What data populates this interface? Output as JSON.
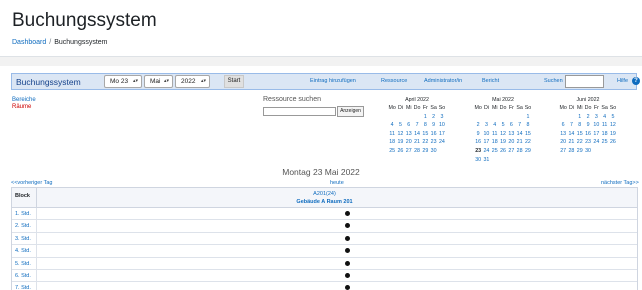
{
  "header": {
    "title": "Buchungssystem",
    "breadcrumb": [
      {
        "label": "Dashboard"
      },
      {
        "label": "Buchungssystem"
      }
    ],
    "separator": "/"
  },
  "toolbar": {
    "title": "Buchungssystem",
    "day_select": "Mo 23",
    "month_select": "Mai",
    "year_select": "2022",
    "start_label": "Start",
    "links": {
      "add_entry": "Eintrag hinzufügen",
      "resources": "Ressource",
      "admin": "Administrator/in",
      "report": "Bericht",
      "search": "Suchen",
      "help": "Hilfe"
    },
    "search_value": ""
  },
  "sidebar": {
    "areas_label": "Bereiche",
    "rooms_label": "Räume"
  },
  "resource_search": {
    "title": "Ressource suchen",
    "input_value": "",
    "button_label": "Anzeigen"
  },
  "calendars": [
    {
      "title": "April 2022",
      "headers": [
        "Mo",
        "Di",
        "Mi",
        "Do",
        "Fr",
        "Sa",
        "So"
      ],
      "cells": [
        "",
        "",
        "",
        "",
        "1",
        "2",
        "3",
        "4",
        "5",
        "6",
        "7",
        "8",
        "9",
        "10",
        "11",
        "12",
        "13",
        "14",
        "15",
        "16",
        "17",
        "18",
        "19",
        "20",
        "21",
        "22",
        "23",
        "24",
        "25",
        "26",
        "27",
        "28",
        "29",
        "30",
        ""
      ],
      "today": ""
    },
    {
      "title": "Mai 2022",
      "headers": [
        "Mo",
        "Di",
        "Mi",
        "Do",
        "Fr",
        "Sa",
        "So"
      ],
      "cells": [
        "",
        "",
        "",
        "",
        "",
        "",
        "1",
        "2",
        "3",
        "4",
        "5",
        "6",
        "7",
        "8",
        "9",
        "10",
        "11",
        "12",
        "13",
        "14",
        "15",
        "16",
        "17",
        "18",
        "19",
        "20",
        "21",
        "22",
        "23",
        "24",
        "25",
        "26",
        "27",
        "28",
        "29",
        "30",
        "31",
        "",
        "",
        "",
        "",
        ""
      ],
      "today": "23"
    },
    {
      "title": "Juni 2022",
      "headers": [
        "Mo",
        "Di",
        "Mi",
        "Do",
        "Fr",
        "Sa",
        "So"
      ],
      "cells": [
        "",
        "",
        "1",
        "2",
        "3",
        "4",
        "5",
        "6",
        "7",
        "8",
        "9",
        "10",
        "11",
        "12",
        "13",
        "14",
        "15",
        "16",
        "17",
        "18",
        "19",
        "20",
        "21",
        "22",
        "23",
        "24",
        "25",
        "26",
        "27",
        "28",
        "29",
        "30",
        "",
        "",
        ""
      ],
      "today": ""
    }
  ],
  "day_view": {
    "title": "Montag 23 Mai 2022",
    "prev_label": "<<vorheriger Tag",
    "today_label": "heute",
    "next_label": "nächster Tag>>",
    "block_header": "Block",
    "room_code": "A201(24)",
    "room_name": "Gebäude A Raum 201",
    "slots": [
      "1. Std.",
      "2. Std.",
      "3. Std.",
      "4. Std.",
      "5. Std.",
      "6. Std.",
      "7. Std."
    ]
  },
  "colors": {
    "link": "#0f6cbf",
    "toolbar_bg": "#dbe6f4",
    "rooms_label": "#cc0000"
  }
}
